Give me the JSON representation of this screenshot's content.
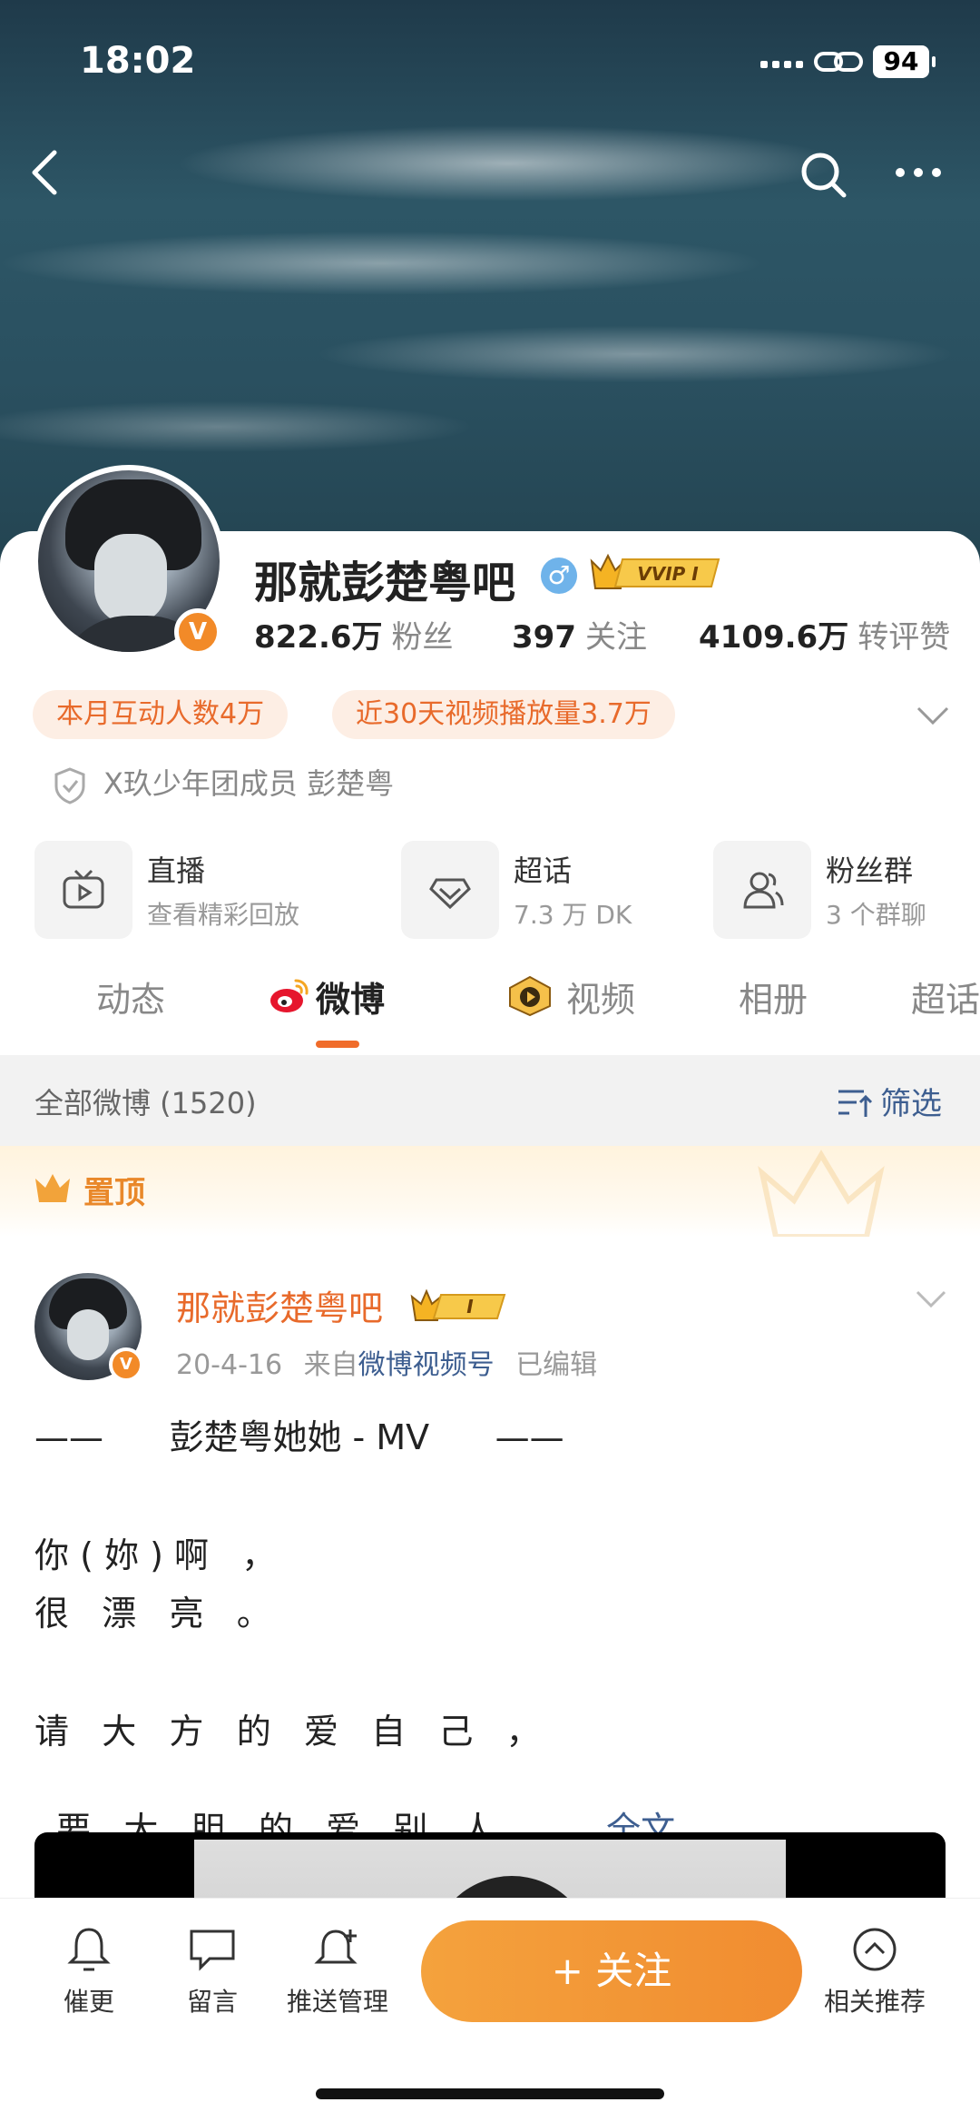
{
  "status_bar": {
    "time": "18:02",
    "battery": "94"
  },
  "profile": {
    "name": "那就彭楚粤吧",
    "vip_badge": "VVIP I",
    "verified_mark": "V",
    "stats": [
      {
        "value": "822.6万",
        "label": "粉丝"
      },
      {
        "value": "397",
        "label": "关注"
      },
      {
        "value": "4109.6万",
        "label": "转评赞"
      }
    ],
    "pills": [
      "本月互动人数4万",
      "近30天视频播放量3.7万"
    ],
    "member_line": "X玖少年团成员 彭楚粤"
  },
  "entries": [
    {
      "title": "直播",
      "subtitle": "查看精彩回放",
      "icon": "tv-icon"
    },
    {
      "title": "超话",
      "subtitle": "7.3 万 DK",
      "icon": "diamond-icon"
    },
    {
      "title": "粉丝群",
      "subtitle": "3 个群聊",
      "icon": "group-icon"
    }
  ],
  "tabs": [
    "动态",
    "微博",
    "视频",
    "相册",
    "超话"
  ],
  "active_tab": "微博",
  "filter_bar": {
    "all_label": "全部微博 (1520)",
    "filter_label": "筛选"
  },
  "pinned_label": "置顶",
  "post": {
    "author": "那就彭楚粤吧",
    "badge": "I",
    "date": "20-4-16",
    "from_prefix": "来自",
    "source": "微博视频号",
    "edited": "已编辑",
    "lines": [
      "——      彭楚粤她她 - MV      ——",
      "你 ( 妳 ) 啊   ，",
      "很   漂   亮   。",
      "请   大   方   的   爱   自   己   ，",
      "要   大   胆   的   爱   别   人   。..."
    ],
    "more_label": "全文"
  },
  "bottom_bar": {
    "items": [
      {
        "label": "催更",
        "icon": "bell-icon"
      },
      {
        "label": "留言",
        "icon": "message-icon"
      },
      {
        "label": "推送管理",
        "icon": "bell-plus-icon"
      },
      {
        "label": "相关推荐",
        "icon": "chevron-up-circle-icon"
      }
    ],
    "follow_label": "+ 关注"
  },
  "colors": {
    "accent": "#f06c2a",
    "link": "#3d5e90",
    "follow": "#f18c30"
  }
}
